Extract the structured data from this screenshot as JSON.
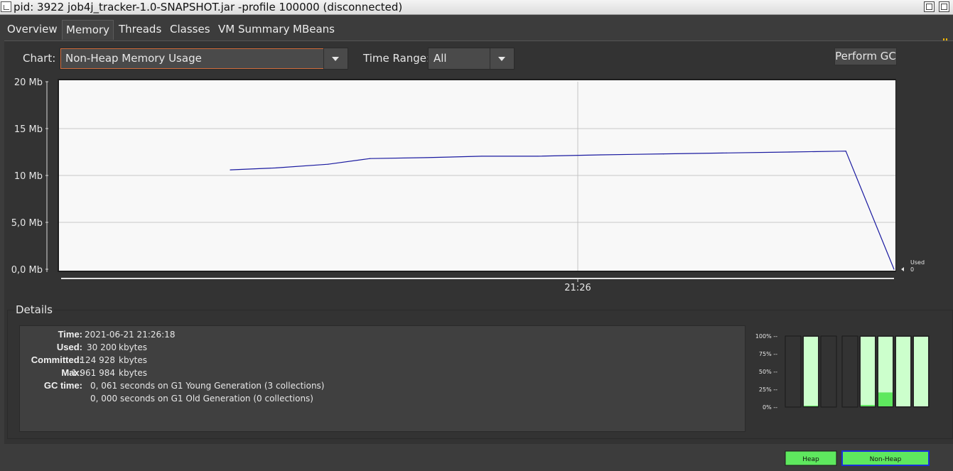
{
  "window": {
    "title": "pid: 3922 job4j_tracker-1.0-SNAPSHOT.jar -profile 100000 (disconnected)"
  },
  "tabs": [
    {
      "label": "Overview"
    },
    {
      "label": "Memory",
      "active": true
    },
    {
      "label": "Threads"
    },
    {
      "label": "Classes"
    },
    {
      "label": "VM Summary"
    },
    {
      "label": "MBeans"
    }
  ],
  "toolbar": {
    "chart_label": "Chart:",
    "chart_value": "Non-Heap Memory Usage",
    "time_range_label": "Time Range:",
    "time_range_value": "All",
    "perform_gc_label": "Perform GC"
  },
  "chart_data": {
    "type": "line",
    "series": [
      {
        "name": "Used",
        "x": [
          0,
          0.065,
          0.14,
          0.2,
          0.28,
          0.36,
          0.44,
          0.53,
          0.62,
          0.71,
          0.8,
          0.881,
          0.95
        ],
        "values": [
          10.6,
          10.8,
          11.2,
          11.8,
          11.9,
          12.05,
          12.05,
          12.2,
          12.3,
          12.4,
          12.5,
          12.6,
          0
        ]
      }
    ],
    "y_ticks": [
      "20 Mb",
      "15 Mb",
      "10 Mb",
      "5,0 Mb",
      "0,0 Mb"
    ],
    "ylim": [
      0,
      20
    ],
    "x_ticks": [
      "21:26"
    ],
    "grid": true,
    "legend": {
      "name": "Used",
      "value": "0"
    }
  },
  "details": {
    "title": "Details",
    "time_label": "Time:",
    "time_value": "2021-06-21 21:26:18",
    "used_label": "Used:",
    "used_num": "30  200",
    "used_unit": "kbytes",
    "committed_label": "Committed:",
    "committed_num": "124  928",
    "committed_unit": "kbytes",
    "max_label": "Max:",
    "max_num": "1  961  984",
    "max_unit": "kbytes",
    "gc_label": "GC time:",
    "gc1_num": "0, 061",
    "gc1_text": "seconds on G1 Young Generation (3 collections)",
    "gc2_num": "0, 000",
    "gc2_text": "seconds on G1 Old Generation (0 collections)"
  },
  "memory_bars": {
    "pct_labels": [
      "100%",
      "75%",
      "50%",
      "25%",
      "0%"
    ],
    "heap_label": "Heap",
    "nonheap_label": "Non-Heap",
    "heap_pools": [
      {
        "committed": 0,
        "used": 0
      },
      {
        "committed": 1.0,
        "used": 0.01
      },
      {
        "committed": 0,
        "used": 0
      }
    ],
    "nonheap_pools": [
      {
        "committed": 0,
        "used": 0
      },
      {
        "committed": 1.0,
        "used": 0.02
      },
      {
        "committed": 1.0,
        "used": 0.2
      },
      {
        "committed": 1.0,
        "used": 0
      },
      {
        "committed": 1.0,
        "used": 0
      }
    ],
    "colors": {
      "committed": "#ccffcc",
      "used": "#5ee85e",
      "frame": "#1a1a1a",
      "highlight": "#1a2fd8"
    }
  }
}
